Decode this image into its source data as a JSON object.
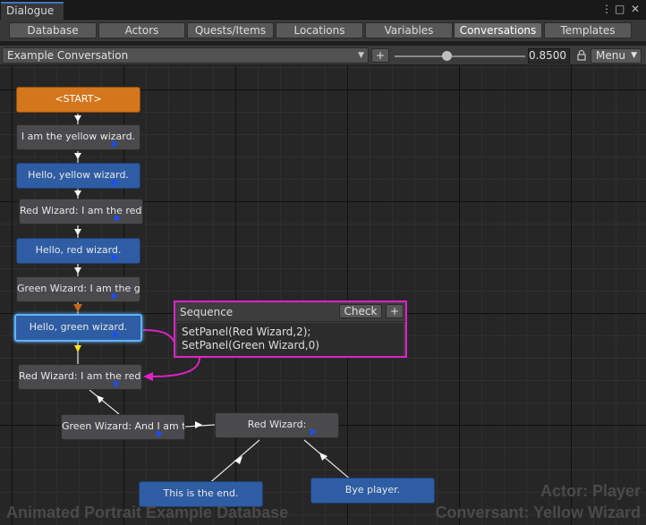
{
  "window": {
    "title": "Dialogue",
    "menu_glyph": "⋮",
    "maximize_glyph": "□",
    "close_glyph": "✕"
  },
  "tabs": [
    {
      "label": "Database"
    },
    {
      "label": "Actors"
    },
    {
      "label": "Quests/Items"
    },
    {
      "label": "Locations"
    },
    {
      "label": "Variables"
    },
    {
      "label": "Conversations",
      "active": true
    },
    {
      "label": "Templates"
    }
  ],
  "toolbar": {
    "conversation": "Example Conversation",
    "add_label": "+",
    "zoom_value": "0.8500",
    "zoom_fraction": 0.4,
    "menu_label": "Menu"
  },
  "nodes": {
    "start": "<START>",
    "n1": "I am the yellow wizard.",
    "n2": "Hello, yellow wizard.",
    "n3": "Red Wizard: I am the red w",
    "n4": "Hello, red wizard.",
    "n5": "Green Wizard: I am the gre",
    "n6": "Hello, green wizard.",
    "n7": "Red Wizard: I am the red W",
    "n8": "Green Wizard: And I am the",
    "n9": "Red Wizard:",
    "n10": "This is the end.",
    "n11": "Bye player."
  },
  "sequence": {
    "label": "Sequence",
    "check_label": "Check",
    "add_label": "+",
    "line1": "SetPanel(Red Wizard,2);",
    "line2": "SetPanel(Green Wizard,0)"
  },
  "watermark": {
    "database": "Animated Portrait Example Database",
    "actor": "Actor: Player",
    "conversant": "Conversant: Yellow Wizard"
  },
  "colors": {
    "start_node": "#d4761c",
    "player_node": "#2e5da3",
    "npc_node": "#4a4a4d",
    "highlight": "#e020c8",
    "tab_accent": "#3a79bb"
  }
}
